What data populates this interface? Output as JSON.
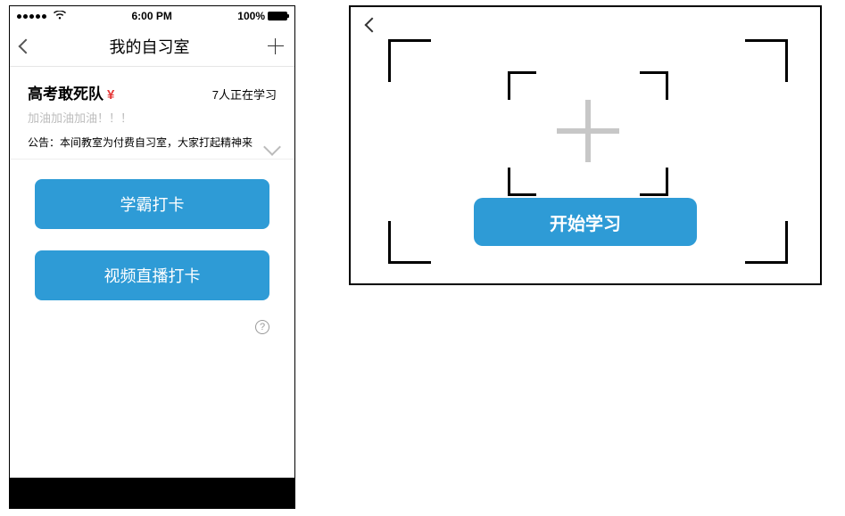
{
  "statusbar": {
    "time": "6:00 PM",
    "battery_pct": "100%"
  },
  "navbar": {
    "title": "我的自习室"
  },
  "room": {
    "name": "高考敢死队",
    "currency": "¥",
    "count_text": "7人正在学习",
    "subtitle": "加油加油加油！！！",
    "notice": "公告：本间教室为付费自习室，大家打起精神来"
  },
  "buttons": {
    "checkin": "学霸打卡",
    "video": "视频直播打卡"
  },
  "help": {
    "label": "?"
  },
  "panel": {
    "start": "开始学习"
  }
}
